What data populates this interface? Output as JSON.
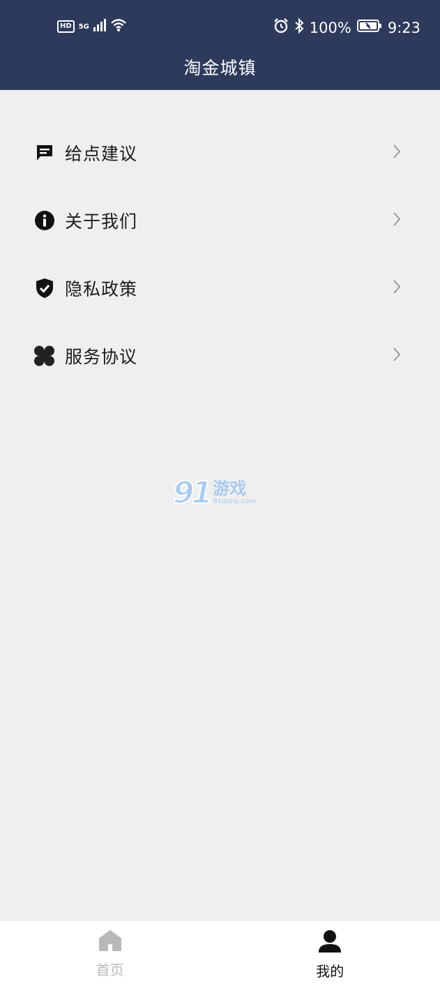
{
  "status_bar": {
    "hd": "HD",
    "network": "5G",
    "battery": "100%",
    "time": "9:23"
  },
  "header": {
    "title": "淘金城镇"
  },
  "menu": {
    "items": [
      {
        "label": "给点建议",
        "icon": "chat-bubble-icon"
      },
      {
        "label": "关于我们",
        "icon": "info-icon"
      },
      {
        "label": "隐私政策",
        "icon": "shield-check-icon"
      },
      {
        "label": "服务协议",
        "icon": "four-leaf-icon"
      }
    ]
  },
  "watermark": {
    "number": "91",
    "text": "游戏",
    "url": "91danji.com"
  },
  "tabbar": {
    "tabs": [
      {
        "label": "首页",
        "icon": "home-icon",
        "active": false
      },
      {
        "label": "我的",
        "icon": "user-icon",
        "active": true
      }
    ]
  },
  "colors": {
    "header_bg": "#2d3a5b",
    "page_bg": "#efeff0",
    "tab_inactive": "#b9b9b9",
    "tab_active": "#111111"
  }
}
